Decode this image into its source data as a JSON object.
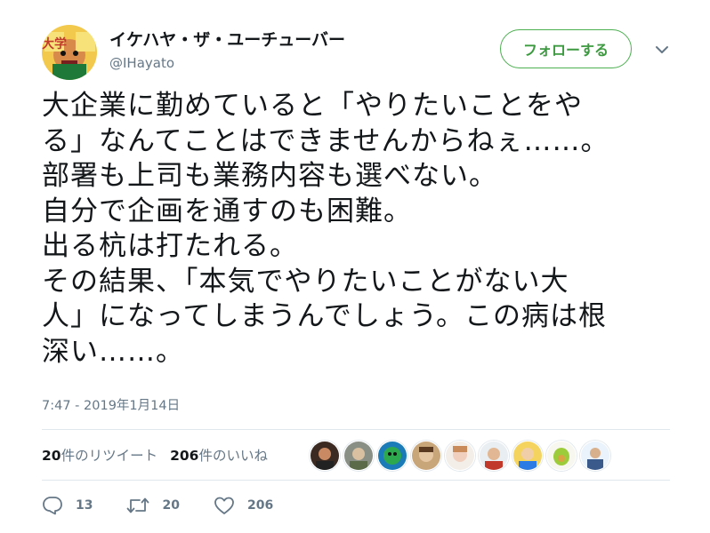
{
  "user": {
    "display_name": "イケハヤ・ザ・ユーチューバー",
    "handle": "@IHayato",
    "avatar_text": "大学"
  },
  "follow_button": {
    "label": "フォローする"
  },
  "menu": {
    "icon": "chevron-down-icon"
  },
  "tweet": {
    "lines": [
      "大企業に勤めていると「やりたいことをや",
      "る」なんてことはできませんからねぇ……。",
      "部署も上司も業務内容も選べない。",
      "自分で企画を通すのも困難。",
      "出る杭は打たれる。",
      "その結果、「本気でやりたいことがない大",
      "人」になってしまうんでしょう。この病は根",
      "深い……。"
    ],
    "timestamp": "7:47 - 2019年1月14日"
  },
  "stats": {
    "retweets_count": "20",
    "retweets_label": "件のリツイート",
    "likes_count": "206",
    "likes_label": "件のいいね"
  },
  "actions": {
    "reply_count": "13",
    "retweet_count": "20",
    "like_count": "206"
  },
  "colors": {
    "accent_green": "#4caf50",
    "muted": "#657786",
    "text": "#14171a"
  }
}
